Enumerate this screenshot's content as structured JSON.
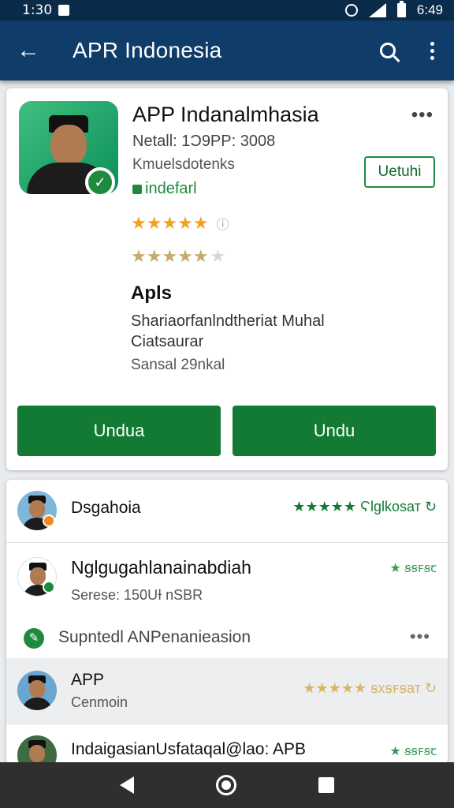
{
  "status_bar": {
    "time": "1:30",
    "clock_right": "6:49"
  },
  "app_bar": {
    "title": "APR Indonesia"
  },
  "app": {
    "name": "APP Indanalmhasia",
    "meta_line1": "Netall: 1Ɔ9PP: 3008",
    "meta_line2": "Kmuelsdotenks",
    "installed_label": "indefarl",
    "open_button": "Uetuhi",
    "rating_primary": 5,
    "rating_secondary": 4.5,
    "rating_extra": "ⓘ",
    "section_title": "Apls",
    "description": "Shariaorfanlndtheriat Muhal Ciatsaurar",
    "size": "Sansal 29nkal",
    "download_left": "Undua",
    "download_right": "Undu"
  },
  "list": [
    {
      "title": "Dsgahoia",
      "subtitle": "",
      "rating_text": "★★★★★ Ϛlglkosат ↻"
    },
    {
      "title": "Nglgugahlanainabdiah",
      "subtitle": "Serese: 150UƗ nSBR",
      "rating_text": "★ ꞩꞩꜰꞩꞇ"
    },
    {
      "title": "Supntedl ANPenanieasion",
      "subtitle": "",
      "rating_text": "•••"
    },
    {
      "title": "APP",
      "subtitle": "Cenmoin",
      "rating_text": "★★★★★ ꞩxꞩꜰꞩат ↻"
    },
    {
      "title": "IndaigasianUsfataqal@lao: APB",
      "subtitle": "",
      "rating_text": "★ ꞩꞩꜰꞩꞇ"
    }
  ],
  "colors": {
    "app_bar": "#0f3c68",
    "status_bar": "#0b2b4a",
    "accent_green": "#127a32",
    "star_orange": "#f2a21e"
  },
  "icons": [
    "back-arrow-icon",
    "search-icon",
    "more-vert-icon",
    "verified-check-icon",
    "lock-icon",
    "pencil-icon",
    "nav-back-icon",
    "nav-home-icon",
    "nav-recents-icon"
  ]
}
